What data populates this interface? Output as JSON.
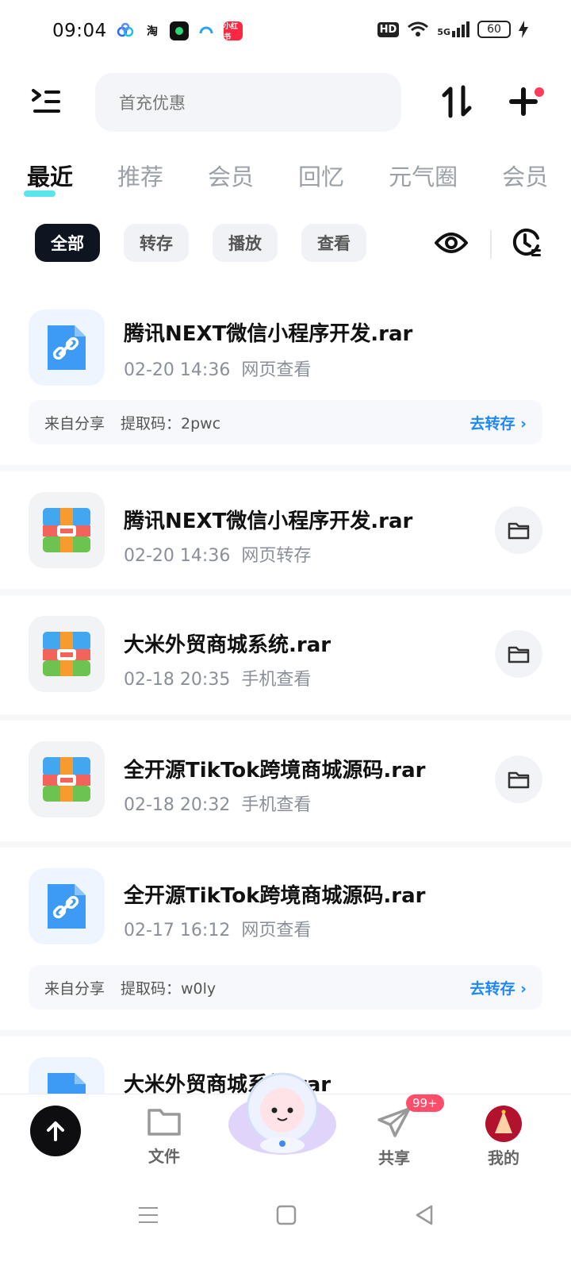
{
  "status_bar": {
    "time": "09:04",
    "network": "5G",
    "hd": "HD",
    "battery": "60",
    "apps": [
      "baidu-netdisk-icon",
      "taobao-icon",
      "app-icon",
      "browser-icon",
      "xiaohongshu-icon"
    ],
    "app_labels": {
      "taobao": "淘"
    }
  },
  "header": {
    "search_placeholder": "首充优惠"
  },
  "tabs": [
    "最近",
    "推荐",
    "会员",
    "回忆",
    "元气圈",
    "会员"
  ],
  "chips": [
    "全部",
    "转存",
    "播放",
    "查看"
  ],
  "items": [
    {
      "title": "腾讯NEXT微信小程序开发.rar",
      "date": "02-20 14:36",
      "action": "网页查看",
      "kind": "link",
      "share": {
        "source": "来自分享",
        "code_label": "提取码：2pwc",
        "button": "去转存"
      }
    },
    {
      "title": "腾讯NEXT微信小程序开发.rar",
      "date": "02-20 14:36",
      "action": "网页转存",
      "kind": "zip"
    },
    {
      "title": "大米外贸商城系统.rar",
      "date": "02-18 20:35",
      "action": "手机查看",
      "kind": "zip"
    },
    {
      "title": "全开源TikTok跨境商城源码.rar",
      "date": "02-18 20:32",
      "action": "手机查看",
      "kind": "zip"
    },
    {
      "title": "全开源TikTok跨境商城源码.rar",
      "date": "02-17 16:12",
      "action": "网页查看",
      "kind": "link",
      "share": {
        "source": "来自分享",
        "code_label": "提取码：w0ly",
        "button": "去转存"
      }
    },
    {
      "title": "大米外贸商城系统.rar",
      "date": "",
      "action": "",
      "kind": "link"
    }
  ],
  "bottom_nav": {
    "files": "文件",
    "share": "共享",
    "share_badge": "99+",
    "me": "我的"
  },
  "colors": {
    "accent": "#1e88f6",
    "dark": "#0f1520",
    "badge": "#ff4d6a"
  }
}
